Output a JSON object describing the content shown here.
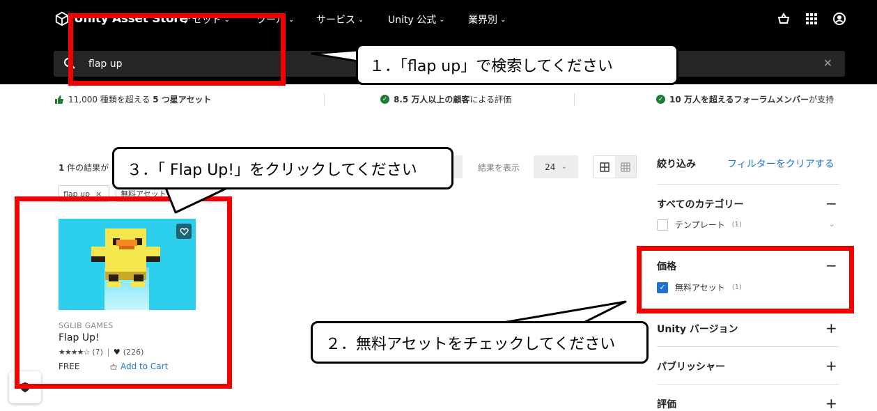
{
  "header": {
    "logo_text": "Unity Asset Store",
    "nav": [
      {
        "label": "アセット"
      },
      {
        "label": "ツール"
      },
      {
        "label": "サービス"
      },
      {
        "label": "Unity 公式"
      },
      {
        "label": "業界別"
      }
    ],
    "icons": [
      "cart-icon",
      "grid-apps-icon",
      "account-icon"
    ]
  },
  "search": {
    "value": "flap up",
    "clear_symbol": "✕"
  },
  "trust_bar": {
    "item1_pre": "11,000 種類を超える ",
    "item1_bold": "5 つ星アセット",
    "item2_bold": "8.5 万人以上の顧客",
    "item2_post": "による評価",
    "item3_bold": "10 万人を超えるフォーラムメンバー",
    "item3_post": "が支持"
  },
  "results": {
    "count_bold": "1",
    "count_text": " 件の結果が",
    "show_label": "結果を表示",
    "per_page": "24",
    "chips": [
      {
        "label": "flap up",
        "remove": "×"
      },
      {
        "label": "無料アセット"
      }
    ]
  },
  "product": {
    "publisher": "SGLIB GAMES",
    "title": "Flap Up!",
    "stars": "★★★★☆",
    "rating_count": "(7)",
    "fav_count": "(226)",
    "price": "FREE",
    "add_to_cart": "Add to Cart"
  },
  "sidebar": {
    "title": "絞り込み",
    "clear": "フィルターをクリアする",
    "sections": {
      "category": {
        "title": "すべてのカテゴリー",
        "toggle": "−",
        "item_label": "テンプレート",
        "item_count": "(1)"
      },
      "price": {
        "title": "価格",
        "toggle": "−",
        "item_label": "無料アセット",
        "item_count": "(1)",
        "checked": true
      },
      "unity_version": {
        "title": "Unity バージョン",
        "toggle": "+"
      },
      "publisher": {
        "title": "パブリッシャー",
        "toggle": "+"
      },
      "rating": {
        "title": "評価",
        "toggle": "+"
      }
    }
  },
  "annotations": {
    "callout1": "１．「flap up」で検索してください",
    "callout2": "２．無料アセットをチェックしてください",
    "callout3": "３．「 Flap Up!」をクリックしてください",
    "highlight_color": "#f40000"
  },
  "colors": {
    "header_bg": "#000000",
    "link_blue": "#1f72d3",
    "card_bg": "#2cd0ed",
    "trust_check": "#1e7b34"
  }
}
